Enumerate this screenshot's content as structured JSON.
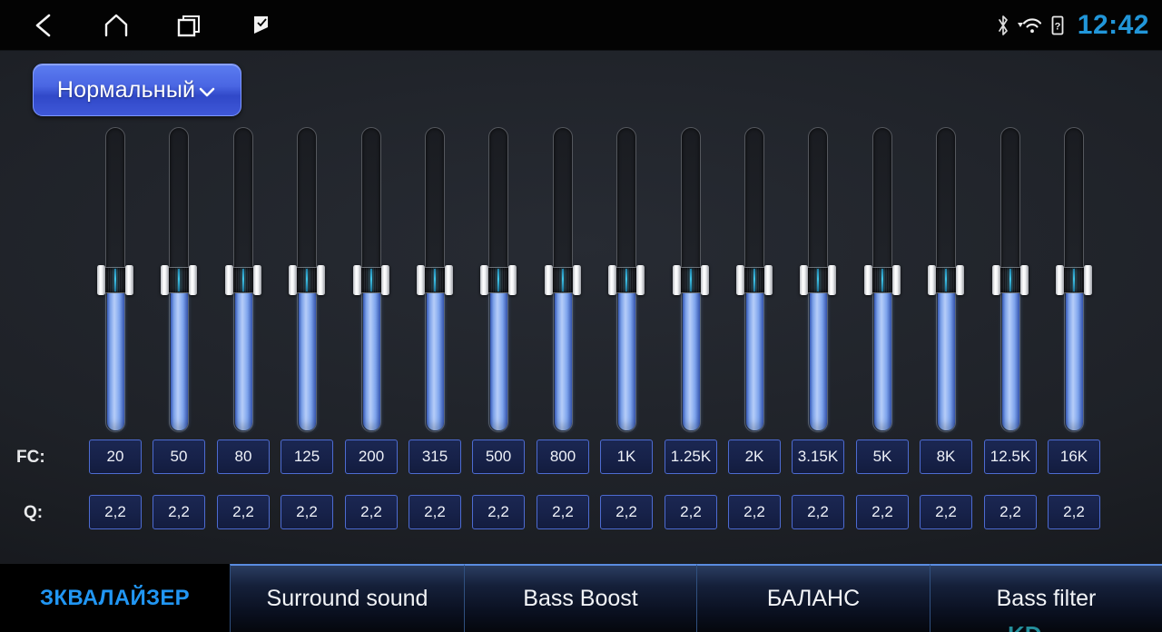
{
  "statusbar": {
    "nav": [
      {
        "name": "back-icon",
        "label": "Back"
      },
      {
        "name": "home-icon",
        "label": "Home"
      },
      {
        "name": "recents-icon",
        "label": "Recent apps"
      },
      {
        "name": "flag-icon",
        "label": "Flag"
      }
    ],
    "icons": [
      {
        "name": "bluetooth-icon",
        "label": "Bluetooth"
      },
      {
        "name": "wifi-icon",
        "label": "Wi-Fi"
      },
      {
        "name": "sim-unknown-icon",
        "label": "SIM unknown"
      }
    ],
    "clock": "12:42"
  },
  "preset": {
    "label": "Нормальный",
    "chevron": "chevron-down-icon"
  },
  "equalizer": {
    "fc_row_label": "FC:",
    "q_row_label": "Q:",
    "bands": [
      {
        "fc": "20",
        "q": "2,2",
        "level": 50
      },
      {
        "fc": "50",
        "q": "2,2",
        "level": 50
      },
      {
        "fc": "80",
        "q": "2,2",
        "level": 50
      },
      {
        "fc": "125",
        "q": "2,2",
        "level": 50
      },
      {
        "fc": "200",
        "q": "2,2",
        "level": 50
      },
      {
        "fc": "315",
        "q": "2,2",
        "level": 50
      },
      {
        "fc": "500",
        "q": "2,2",
        "level": 50
      },
      {
        "fc": "800",
        "q": "2,2",
        "level": 50
      },
      {
        "fc": "1K",
        "q": "2,2",
        "level": 50
      },
      {
        "fc": "1.25K",
        "q": "2,2",
        "level": 50
      },
      {
        "fc": "2K",
        "q": "2,2",
        "level": 50
      },
      {
        "fc": "3.15K",
        "q": "2,2",
        "level": 50
      },
      {
        "fc": "5K",
        "q": "2,2",
        "level": 50
      },
      {
        "fc": "8K",
        "q": "2,2",
        "level": 50
      },
      {
        "fc": "12.5K",
        "q": "2,2",
        "level": 50
      },
      {
        "fc": "16K",
        "q": "2,2",
        "level": 50
      }
    ]
  },
  "tabs": [
    {
      "label": "ЗКВАЛАЙЗЕР",
      "active": true
    },
    {
      "label": "Surround sound",
      "active": false
    },
    {
      "label": "Bass Boost",
      "active": false
    },
    {
      "label": "БАЛАНС",
      "active": false
    },
    {
      "label": "Bass filter",
      "active": false
    }
  ],
  "watermark": "KD",
  "colors": {
    "accent_blue": "#2196f3",
    "preset_blue": "#4a66e3",
    "slider_fill": "#8fb2f2",
    "cell_border": "#4d6bd1",
    "background": "#1e2127"
  }
}
